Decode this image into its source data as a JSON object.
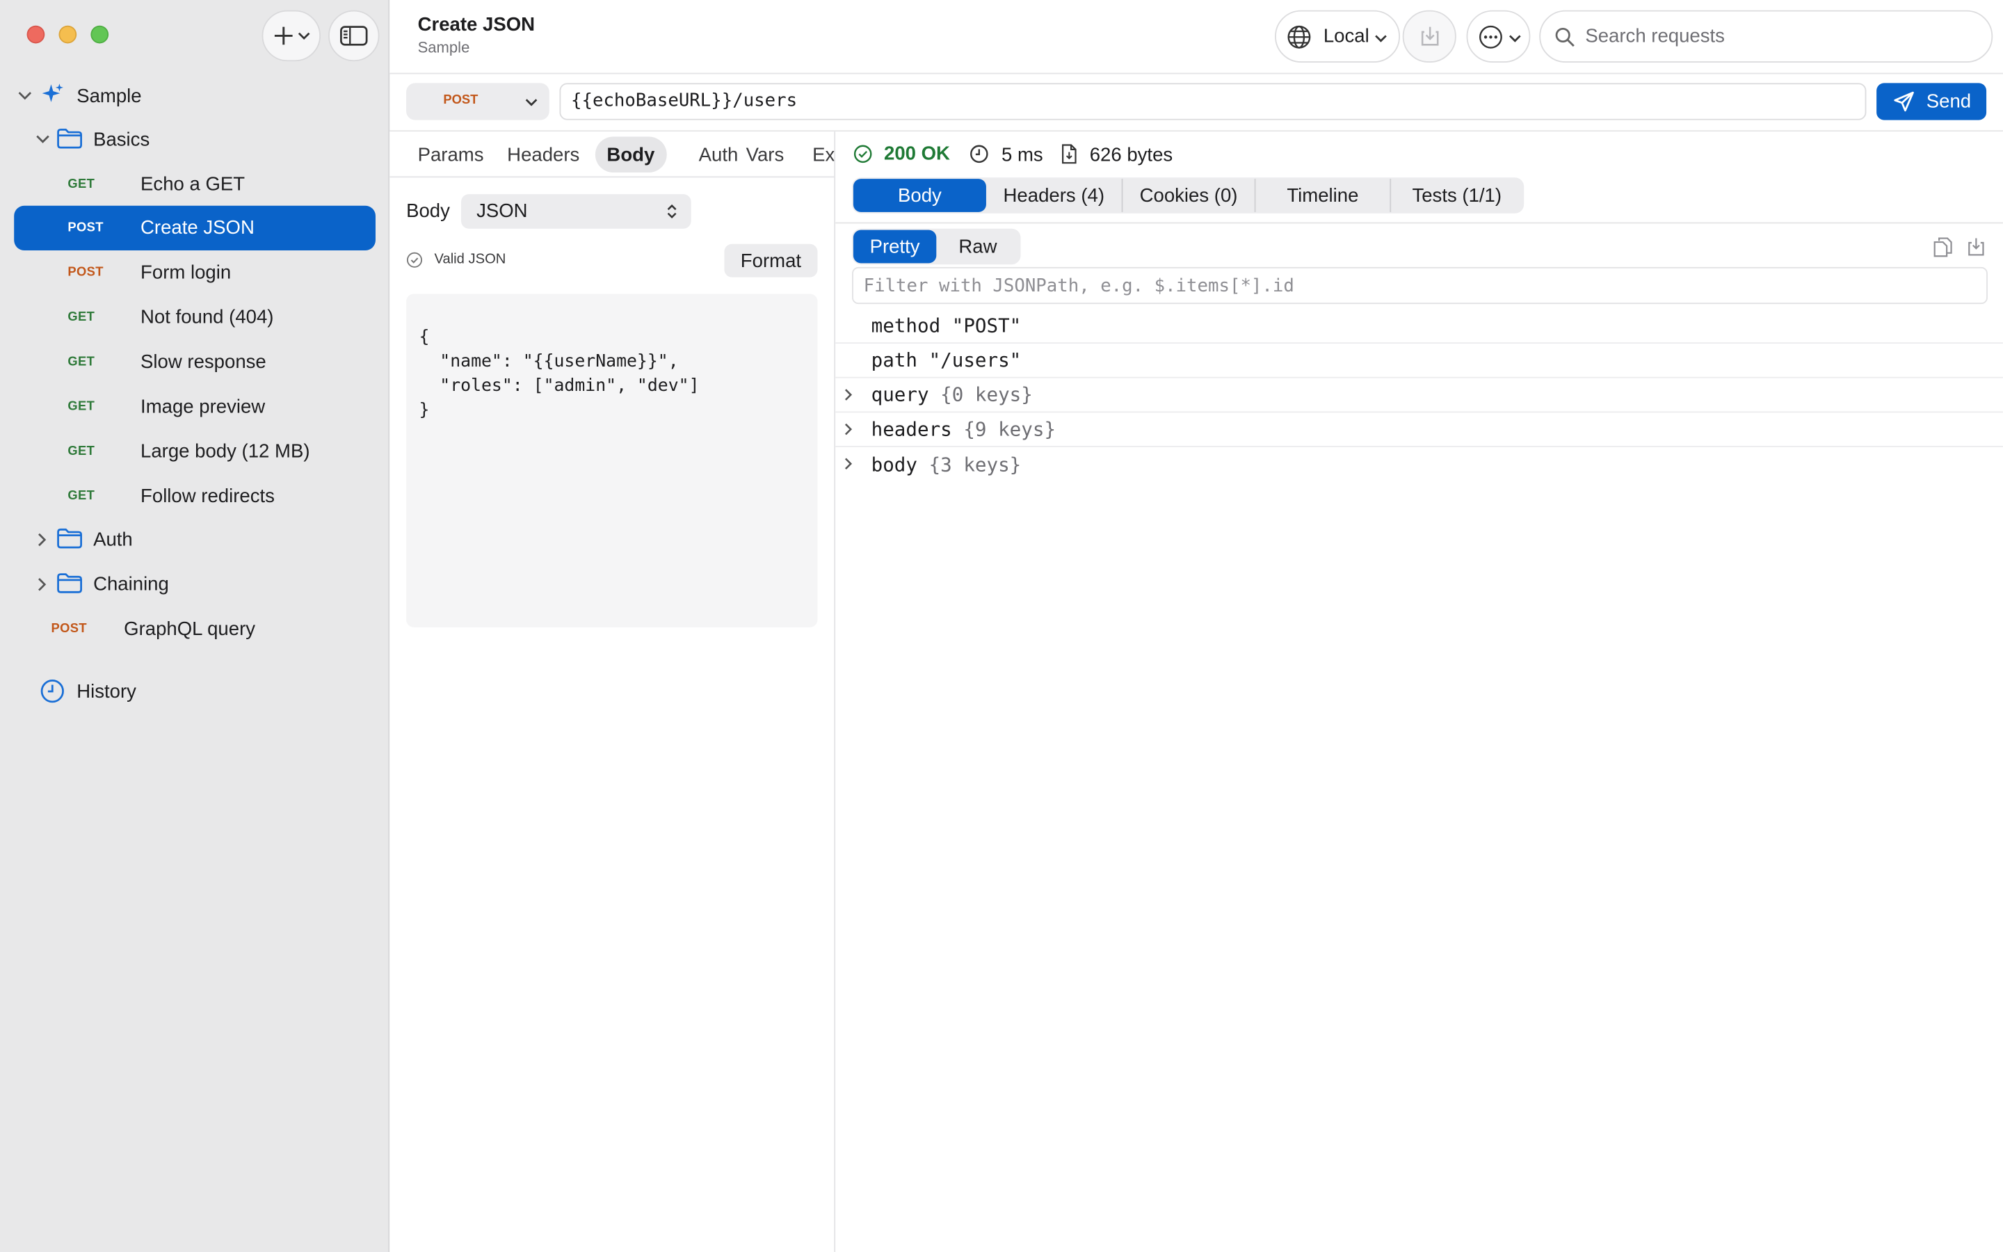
{
  "sidebar": {
    "root": {
      "label": "Sample"
    },
    "folder_basics": {
      "label": "Basics"
    },
    "requests": [
      {
        "method": "GET",
        "label": "Echo a GET"
      },
      {
        "method": "POST",
        "label": "Create JSON"
      },
      {
        "method": "POST",
        "label": "Form login"
      },
      {
        "method": "GET",
        "label": "Not found (404)"
      },
      {
        "method": "GET",
        "label": "Slow response"
      },
      {
        "method": "GET",
        "label": "Image preview"
      },
      {
        "method": "GET",
        "label": "Large body (12 MB)"
      },
      {
        "method": "GET",
        "label": "Follow redirects"
      }
    ],
    "folder_auth": {
      "label": "Auth"
    },
    "folder_chaining": {
      "label": "Chaining"
    },
    "graphql": {
      "method": "POST",
      "label": "GraphQL query"
    },
    "history": {
      "label": "History"
    }
  },
  "header": {
    "title": "Create JSON",
    "subtitle": "Sample",
    "environment": "Local",
    "search_placeholder": "Search requests"
  },
  "urlbar": {
    "method": "POST",
    "url": "{{echoBaseURL}}/users",
    "send_label": "Send"
  },
  "request": {
    "tabs": [
      "Params",
      "Headers",
      "Body",
      "Auth",
      "Vars",
      "Ext"
    ],
    "active_tab": "Body",
    "body_label": "Body",
    "body_type": "JSON",
    "valid_label": "Valid JSON",
    "format_label": "Format",
    "body_lines": [
      "{",
      "  \"name\": \"{{userName}}\",",
      "  \"roles\": [\"admin\", \"dev\"]",
      "}"
    ]
  },
  "response": {
    "status": "200 OK",
    "time": "5 ms",
    "size": "626 bytes",
    "tabs": [
      "Body",
      "Headers (4)",
      "Cookies (0)",
      "Timeline",
      "Tests (1/1)"
    ],
    "view_modes": [
      "Pretty",
      "Raw"
    ],
    "filter_placeholder": "Filter with JSONPath, e.g. $.items[*].id",
    "tree": [
      {
        "key": "method",
        "value": "\"POST\"",
        "expandable": false
      },
      {
        "key": "path",
        "value": "\"/users\"",
        "expandable": false
      },
      {
        "key": "query",
        "value": "{0 keys}",
        "expandable": true
      },
      {
        "key": "headers",
        "value": "{9 keys}",
        "expandable": true
      },
      {
        "key": "body",
        "value": "{3 keys}",
        "expandable": true
      }
    ]
  },
  "colors": {
    "accent": "#0a63c9",
    "get": "#2f7a3a",
    "post": "#c2571a",
    "status_ok": "#1f7a35"
  }
}
